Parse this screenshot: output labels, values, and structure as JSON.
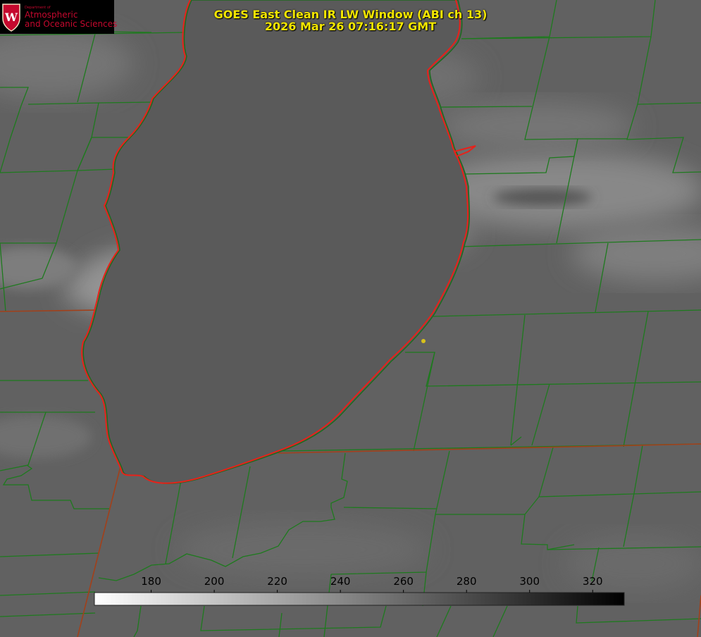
{
  "title": {
    "line1": "GOES East Clean IR LW Window (ABI ch 13)",
    "line2": "2026 Mar 26 07:16:17 GMT"
  },
  "logo": {
    "department": "Department of",
    "line1": "Atmospheric",
    "line2": "and Oceanic Sciences",
    "seal_letter": "W"
  },
  "colorbar": {
    "min": 162,
    "max": 330,
    "ticks": [
      180,
      200,
      220,
      240,
      260,
      280,
      300,
      320
    ],
    "from_color": "#ffffff",
    "to_color": "#000000"
  },
  "colors": {
    "county_lines": "#1e7a1e",
    "shoreline": "#e8211a",
    "state_lines": "#a2401a",
    "title_text": "#f3e600",
    "marker": "#d8c21a"
  }
}
